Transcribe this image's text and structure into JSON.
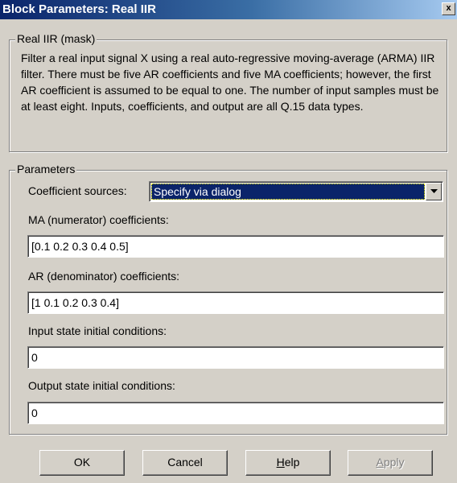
{
  "window": {
    "title": "Block Parameters: Real IIR",
    "close_glyph": "x"
  },
  "mask_group": {
    "legend": "Real IIR (mask)",
    "description": "Filter a real input signal X using a real auto-regressive moving-average (ARMA) IIR filter. There must be five AR coefficients and five MA coefficients; however, the first AR coefficient is assumed to be equal to one. The number of input samples must be at least eight. Inputs, coefficients, and output are all Q.15 data types."
  },
  "parameters": {
    "legend": "Parameters",
    "coefficient_sources": {
      "label": "Coefficient sources:",
      "value": "Specify via dialog",
      "icon": "chevron-down-icon"
    },
    "ma_coefficients": {
      "label": "MA (numerator) coefficients:",
      "value": "[0.1 0.2 0.3 0.4 0.5]"
    },
    "ar_coefficients": {
      "label": "AR (denominator) coefficients:",
      "value": "[1 0.1 0.2 0.3 0.4]"
    },
    "input_state": {
      "label": "Input state initial conditions:",
      "value": "0"
    },
    "output_state": {
      "label": "Output state initial conditions:",
      "value": "0"
    }
  },
  "buttons": {
    "ok": "OK",
    "cancel": "Cancel",
    "help_mnemonic": "H",
    "help_rest": "elp",
    "apply_mnemonic": "A",
    "apply_rest": "pply"
  }
}
